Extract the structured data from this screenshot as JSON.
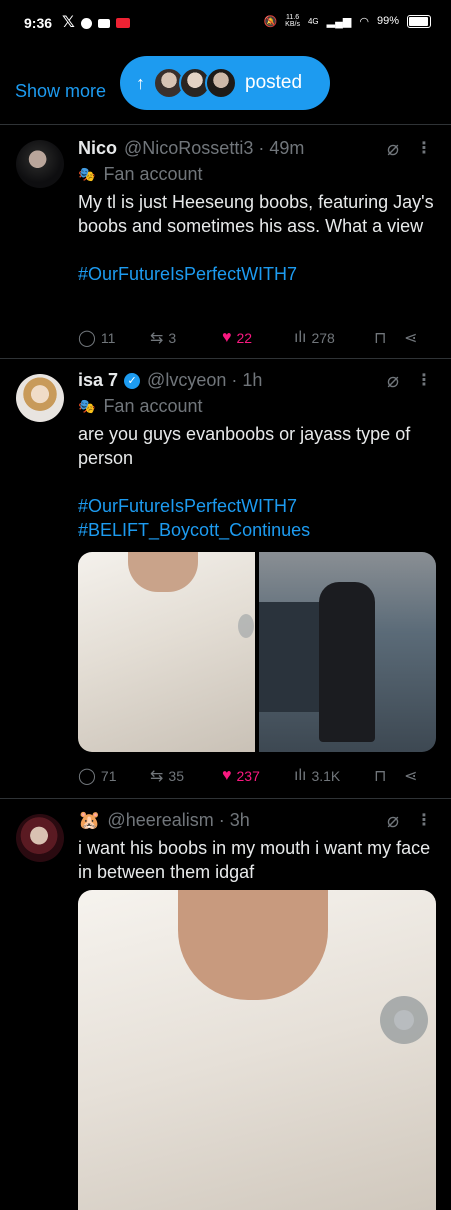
{
  "status_bar": {
    "time": "9:36",
    "speed": "11.6\nKB/s",
    "network": "4G",
    "battery": "99%"
  },
  "top": {
    "show_more": "Show more",
    "posted_label": "posted"
  },
  "tweets": [
    {
      "name": "Nico",
      "handle": "@NicoRossetti3 · 49m",
      "label": "Fan account",
      "text": "My tl is just Heeseung boobs, featuring Jay's boobs and sometimes his ass. What a view",
      "hashtags": [
        "#OurFutureIsPerfectWITH7"
      ],
      "replies": "11",
      "reposts": "3",
      "likes": "22",
      "views": "278"
    },
    {
      "name": "isa 7",
      "handle": "@lvcyeon · 1h",
      "label": "Fan account",
      "text": "are you guys evanboobs or jayass type of person",
      "hashtags": [
        "#OurFutureIsPerfectWITH7",
        "#BELIFT_Boycott_Continues"
      ],
      "replies": "71",
      "reposts": "35",
      "likes": "237",
      "views": "3.1K"
    },
    {
      "name_emoji": "🐹",
      "handle": "@heerealism · 3h",
      "text": "i want his boobs in my mouth i want my face in between them idgaf"
    }
  ],
  "icons": {
    "reply": "reply-icon",
    "repost": "repost-icon",
    "like": "heart-icon",
    "views": "views-icon",
    "bookmark": "bookmark-icon",
    "share": "share-icon",
    "grok": "grok-icon",
    "more": "more-icon"
  },
  "colors": {
    "accent": "#1d9bf0",
    "like": "#f91880",
    "muted": "#71767b",
    "background": "#000000"
  }
}
